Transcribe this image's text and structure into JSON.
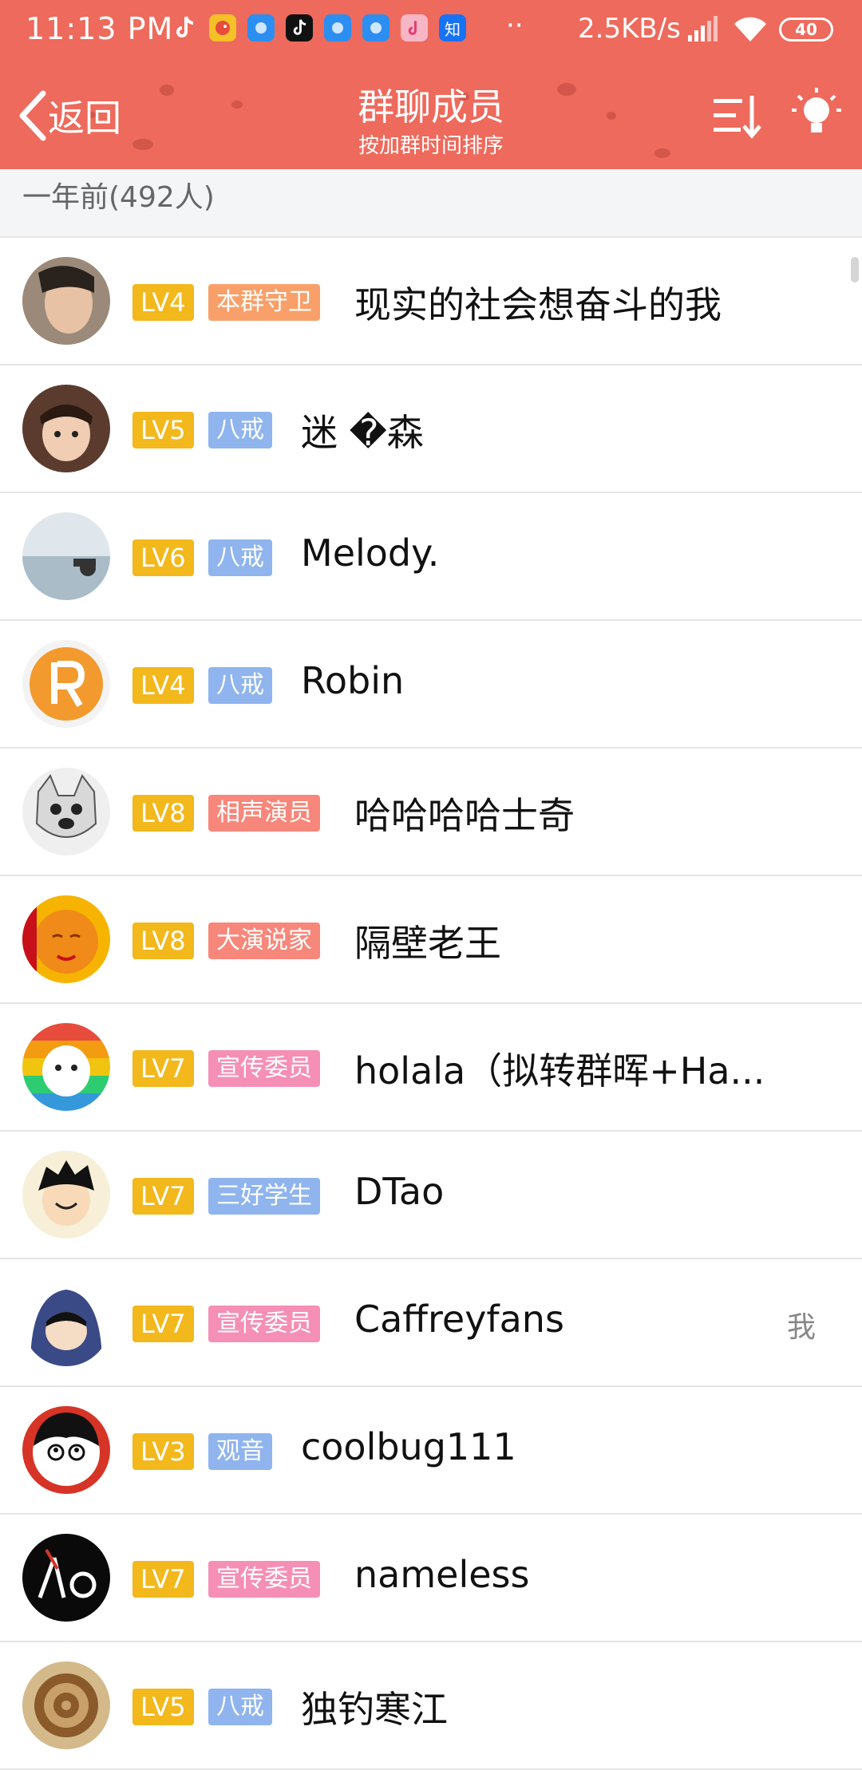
{
  "status_bar": {
    "time": "11:13 PM",
    "network_speed": "2.5KB/s",
    "battery": "40",
    "app_icons": [
      "tiktok-icon",
      "bird-app-icon",
      "blue-app-icon",
      "tiktok-icon",
      "blue-app-icon",
      "blue-app-icon",
      "music-icon",
      "zhihu-icon"
    ],
    "zhihu_label": "知",
    "dots": "··"
  },
  "header": {
    "back_label": "返回",
    "title": "群聊成员",
    "subtitle": "按加群时间排序",
    "bg_color": "#ee6a5c"
  },
  "section": {
    "label": "一年前(492人)"
  },
  "colors": {
    "level_badge": "#f2b81c",
    "orange_badge": "#f9a06a",
    "blue_badge": "#8fb4ee",
    "pink_badge": "#f58fb6",
    "salmon_badge": "#f7877a"
  },
  "members": [
    {
      "level": "LV4",
      "title": "本群守卫",
      "title_color": "#f9a06a",
      "name": "现实的社会想奋斗的我",
      "me": ""
    },
    {
      "level": "LV5",
      "title": "八戒",
      "title_color": "#8fb4ee",
      "name": "迷 �森",
      "me": ""
    },
    {
      "level": "LV6",
      "title": "八戒",
      "title_color": "#8fb4ee",
      "name": "Melody.",
      "me": ""
    },
    {
      "level": "LV4",
      "title": "八戒",
      "title_color": "#8fb4ee",
      "name": "Robin",
      "me": ""
    },
    {
      "level": "LV8",
      "title": "相声演员",
      "title_color": "#f7877a",
      "name": "哈哈哈哈士奇",
      "me": ""
    },
    {
      "level": "LV8",
      "title": "大演说家",
      "title_color": "#f7877a",
      "name": "隔壁老王",
      "me": ""
    },
    {
      "level": "LV7",
      "title": "宣传委员",
      "title_color": "#f58fb6",
      "name": "holala（拟转群晖+Ha...",
      "me": ""
    },
    {
      "level": "LV7",
      "title": "三好学生",
      "title_color": "#8fb4ee",
      "name": "DTao",
      "me": ""
    },
    {
      "level": "LV7",
      "title": "宣传委员",
      "title_color": "#f58fb6",
      "name": "Caffreyfans",
      "me": "我"
    },
    {
      "level": "LV3",
      "title": "观音",
      "title_color": "#8fb4ee",
      "name": "coolbug111",
      "me": ""
    },
    {
      "level": "LV7",
      "title": "宣传委员",
      "title_color": "#f58fb6",
      "name": "nameless",
      "me": ""
    },
    {
      "level": "LV5",
      "title": "八戒",
      "title_color": "#8fb4ee",
      "name": "独钓寒江",
      "me": ""
    }
  ]
}
